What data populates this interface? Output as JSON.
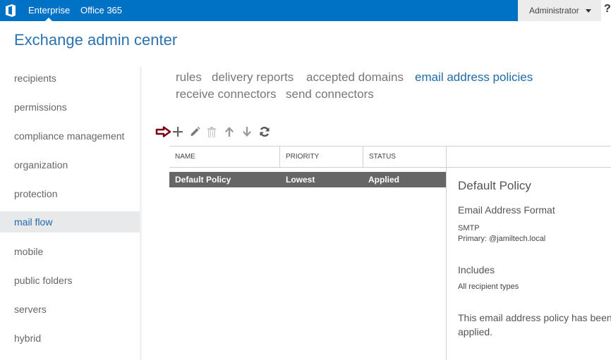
{
  "topbar": {
    "logo_icon": "office-logo-icon",
    "links": [
      "Enterprise",
      "Office 365"
    ],
    "active_link": "Enterprise",
    "user": "Administrator",
    "help": "?"
  },
  "app_title": "Exchange admin center",
  "sidebar": {
    "items": [
      {
        "label": "recipients"
      },
      {
        "label": "permissions"
      },
      {
        "label": "compliance management"
      },
      {
        "label": "organization"
      },
      {
        "label": "protection"
      },
      {
        "label": "mail flow",
        "active": true
      },
      {
        "label": "mobile"
      },
      {
        "label": "public folders"
      },
      {
        "label": "servers"
      },
      {
        "label": "hybrid"
      }
    ]
  },
  "subtabs": [
    {
      "label": "rules"
    },
    {
      "label": "delivery reports"
    },
    {
      "label": "accepted domains"
    },
    {
      "label": "email address policies",
      "active": true
    },
    {
      "label": "receive connectors"
    },
    {
      "label": "send connectors"
    }
  ],
  "toolbar": {
    "annotation_icon": "arrow-pointer-icon",
    "buttons": [
      "add",
      "edit",
      "delete",
      "move-up",
      "move-down",
      "refresh"
    ],
    "annotation_color": "#7a0016"
  },
  "list": {
    "columns": [
      "NAME",
      "PRIORITY",
      "STATUS"
    ],
    "rows": [
      {
        "name": "Default Policy",
        "priority": "Lowest",
        "status": "Applied",
        "selected": true
      }
    ]
  },
  "details": {
    "title": "Default Policy",
    "format_heading": "Email Address Format",
    "format_type": "SMTP",
    "format_primary": "Primary: @jamiltech.local",
    "includes_heading": "Includes",
    "includes_value": "All recipient types",
    "status_text": "This email address policy has been applied."
  },
  "colors": {
    "brand": "#0072c6",
    "accent_text": "#1e6aa8",
    "selected_row": "#666666"
  }
}
